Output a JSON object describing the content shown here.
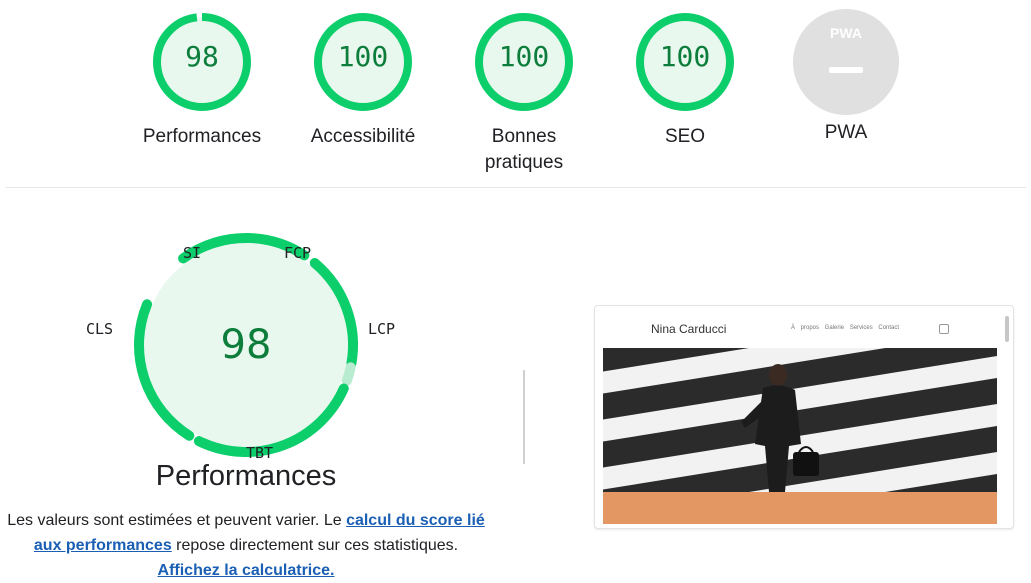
{
  "colors": {
    "pass_green": "#0cce6b",
    "pass_text": "#0c7d3a",
    "pass_fill": "#e8f8ee",
    "pwa_grey": "#e0e0e0",
    "orange_band": "#e39763"
  },
  "summary": [
    {
      "id": "performance",
      "score": "98",
      "label": "Performances",
      "fraction": 0.98
    },
    {
      "id": "accessibility",
      "score": "100",
      "label": "Accessibilité",
      "fraction": 1.0
    },
    {
      "id": "best-practices",
      "score": "100",
      "label": "Bonnes pratiques",
      "fraction": 1.0
    },
    {
      "id": "seo",
      "score": "100",
      "label": "SEO",
      "fraction": 1.0
    }
  ],
  "pwa": {
    "badge": "PWA",
    "label": "PWA"
  },
  "performance_detail": {
    "score": "98",
    "title": "Performances",
    "metrics": {
      "si": "SI",
      "fcp": "FCP",
      "lcp": "LCP",
      "tbt": "TBT",
      "cls": "CLS"
    },
    "description": {
      "part1": "Les valeurs sont estimées et peuvent varier. Le ",
      "link1": "calcul du score lié aux performances",
      "part2": " repose directement sur ces statistiques. ",
      "link2": "Affichez la calculatrice."
    }
  },
  "screenshot": {
    "site_name": "Nina Carducci",
    "nav_links": "À propos Galerie Services Contact"
  }
}
